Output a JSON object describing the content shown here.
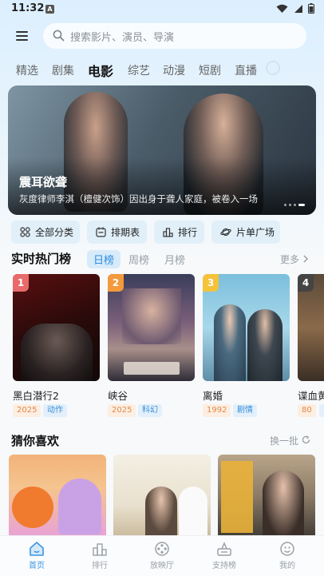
{
  "status": {
    "time": "11:32",
    "notif_letter": "A"
  },
  "search": {
    "placeholder": "搜索影片、演员、导演"
  },
  "tabs": [
    "精选",
    "剧集",
    "电影",
    "综艺",
    "动漫",
    "短剧",
    "直播"
  ],
  "active_tab": "电影",
  "banner": {
    "title": "震耳欲聋",
    "desc": "灰度律师李淇（檀健次饰）因出身于聋人家庭，被卷入一场…"
  },
  "quick": {
    "all": "全部分类",
    "schedule": "排期表",
    "rank": "排行",
    "lists": "片单广场"
  },
  "hot": {
    "title": "实时热门榜",
    "tabs": [
      "日榜",
      "周榜",
      "月榜"
    ],
    "more": "更多",
    "items": [
      {
        "rank": "1",
        "title": "黑白潜行2",
        "year": "2025",
        "genre": "动作"
      },
      {
        "rank": "2",
        "title": "峡谷",
        "year": "2025",
        "genre": "科幻"
      },
      {
        "rank": "3",
        "title": "离婚",
        "year": "1992",
        "genre": "剧情"
      },
      {
        "rank": "4",
        "title": "谍血黄",
        "year": "80",
        "genre": ""
      }
    ]
  },
  "guess": {
    "title": "猜你喜欢",
    "refresh": "换一批"
  },
  "nav": [
    "首页",
    "排行",
    "放映厅",
    "支持榜",
    "我的"
  ],
  "colors": {
    "accent": "#3a96e6",
    "rank1": "#e86a6a",
    "rank2": "#f29a3c",
    "rank3": "#f5c23a",
    "rank4": "#8c8c8c"
  }
}
